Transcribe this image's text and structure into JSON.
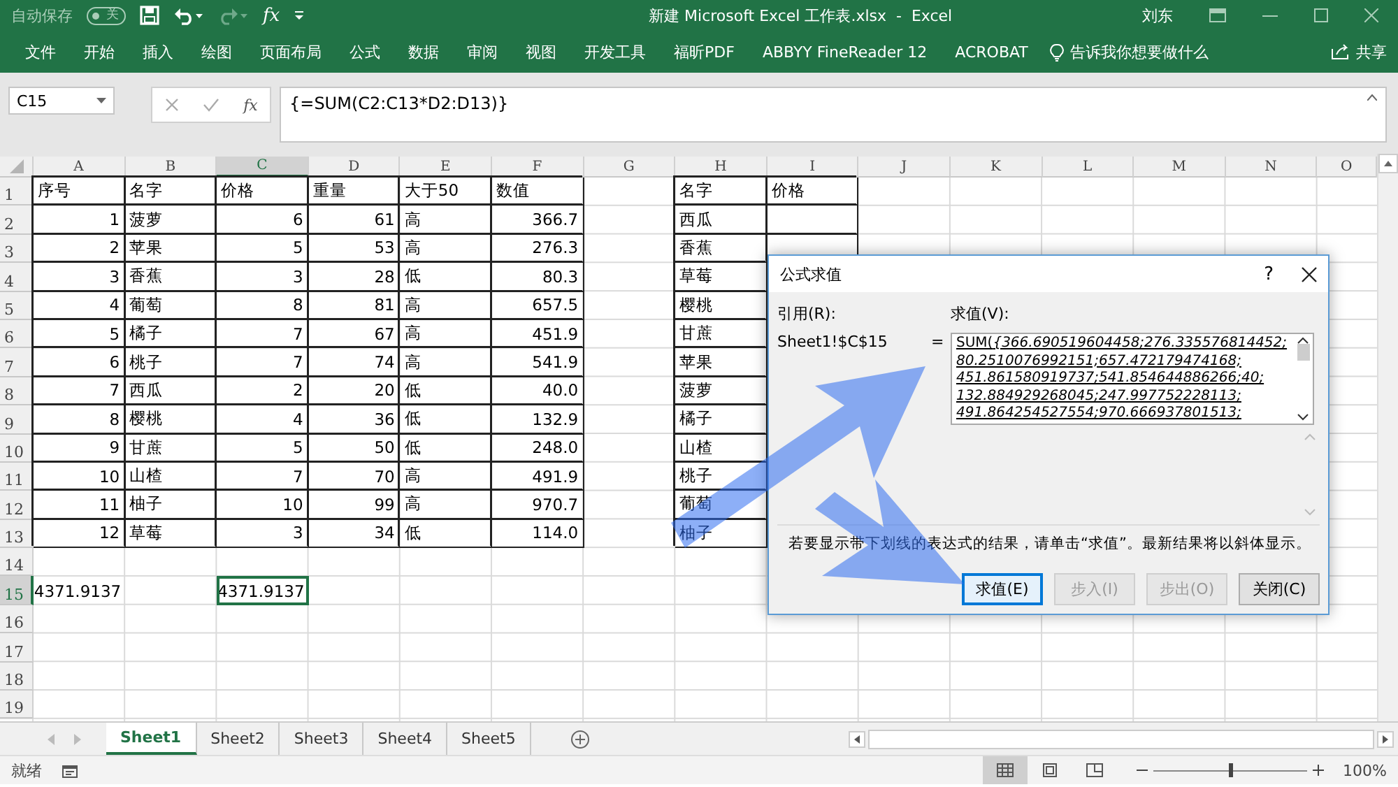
{
  "title_bar": {
    "autosave_label": "自动保存",
    "autosave_state": "关",
    "autosave_on": false,
    "function_glyph": "fx",
    "title": "新建 Microsoft Excel 工作表.xlsx  -  Excel",
    "user": "刘东"
  },
  "ribbon_tabs": [
    "文件",
    "开始",
    "插入",
    "绘图",
    "页面布局",
    "公式",
    "数据",
    "审阅",
    "视图",
    "开发工具",
    "福昕PDF",
    "ABBYY FineReader 12",
    "ACROBAT"
  ],
  "tell_me": "告诉我你想要做什么",
  "share": "共享",
  "formula_bar": {
    "name_box": "C15",
    "function_glyph": "fx",
    "formula": "{=SUM(C2:C13*D2:D13)}"
  },
  "sheet": {
    "columns": [
      {
        "label": "A",
        "selected": false
      },
      {
        "label": "B",
        "selected": false
      },
      {
        "label": "C",
        "selected": true
      },
      {
        "label": "D",
        "selected": false
      },
      {
        "label": "E",
        "selected": false
      },
      {
        "label": "F",
        "selected": false
      },
      {
        "label": "G",
        "selected": false
      },
      {
        "label": "H",
        "selected": false
      },
      {
        "label": "I",
        "selected": false
      },
      {
        "label": "J",
        "selected": false
      },
      {
        "label": "K",
        "selected": false
      },
      {
        "label": "L",
        "selected": false
      },
      {
        "label": "M",
        "selected": false
      },
      {
        "label": "N",
        "selected": false
      },
      {
        "label": "O",
        "selected": false
      }
    ],
    "rows": [
      {
        "header": "1",
        "selected": false,
        "cells": [
          {
            "text": "序号",
            "kind": "text",
            "bordered": true
          },
          {
            "text": "名字",
            "kind": "text",
            "bordered": true
          },
          {
            "text": "价格",
            "kind": "text",
            "bordered": true
          },
          {
            "text": "重量",
            "kind": "text",
            "bordered": true
          },
          {
            "text": "大于50",
            "kind": "text",
            "bordered": true
          },
          {
            "text": "数值",
            "kind": "text",
            "bordered": true
          },
          null,
          {
            "text": "名字",
            "kind": "text",
            "bordered": true
          },
          {
            "text": "价格",
            "kind": "text",
            "bordered": true
          }
        ]
      },
      {
        "header": "2",
        "selected": false,
        "cells": [
          {
            "text": "1",
            "kind": "number",
            "bordered": true
          },
          {
            "text": "菠萝",
            "kind": "text",
            "bordered": true
          },
          {
            "text": "6",
            "kind": "number",
            "bordered": true
          },
          {
            "text": "61",
            "kind": "number",
            "bordered": true
          },
          {
            "text": "高",
            "kind": "text",
            "bordered": true
          },
          {
            "text": "366.7",
            "kind": "number",
            "bordered": true
          },
          null,
          {
            "text": "西瓜",
            "kind": "text",
            "bordered": true
          },
          {
            "bordered": true
          }
        ]
      },
      {
        "header": "3",
        "selected": false,
        "cells": [
          {
            "text": "2",
            "kind": "number",
            "bordered": true
          },
          {
            "text": "苹果",
            "kind": "text",
            "bordered": true
          },
          {
            "text": "5",
            "kind": "number",
            "bordered": true
          },
          {
            "text": "53",
            "kind": "number",
            "bordered": true
          },
          {
            "text": "高",
            "kind": "text",
            "bordered": true
          },
          {
            "text": "276.3",
            "kind": "number",
            "bordered": true
          },
          null,
          {
            "text": "香蕉",
            "kind": "text",
            "bordered": true
          },
          {
            "bordered": true
          }
        ]
      },
      {
        "header": "4",
        "selected": false,
        "cells": [
          {
            "text": "3",
            "kind": "number",
            "bordered": true
          },
          {
            "text": "香蕉",
            "kind": "text",
            "bordered": true
          },
          {
            "text": "3",
            "kind": "number",
            "bordered": true
          },
          {
            "text": "28",
            "kind": "number",
            "bordered": true
          },
          {
            "text": "低",
            "kind": "text",
            "bordered": true
          },
          {
            "text": "80.3",
            "kind": "number",
            "bordered": true
          },
          null,
          {
            "text": "草莓",
            "kind": "text",
            "bordered": true
          }
        ]
      },
      {
        "header": "5",
        "selected": false,
        "cells": [
          {
            "text": "4",
            "kind": "number",
            "bordered": true
          },
          {
            "text": "葡萄",
            "kind": "text",
            "bordered": true
          },
          {
            "text": "8",
            "kind": "number",
            "bordered": true
          },
          {
            "text": "81",
            "kind": "number",
            "bordered": true
          },
          {
            "text": "高",
            "kind": "text",
            "bordered": true
          },
          {
            "text": "657.5",
            "kind": "number",
            "bordered": true
          },
          null,
          {
            "text": "樱桃",
            "kind": "text",
            "bordered": true
          }
        ]
      },
      {
        "header": "6",
        "selected": false,
        "cells": [
          {
            "text": "5",
            "kind": "number",
            "bordered": true
          },
          {
            "text": "橘子",
            "kind": "text",
            "bordered": true
          },
          {
            "text": "7",
            "kind": "number",
            "bordered": true
          },
          {
            "text": "67",
            "kind": "number",
            "bordered": true
          },
          {
            "text": "高",
            "kind": "text",
            "bordered": true
          },
          {
            "text": "451.9",
            "kind": "number",
            "bordered": true
          },
          null,
          {
            "text": "甘蔗",
            "kind": "text",
            "bordered": true
          }
        ]
      },
      {
        "header": "7",
        "selected": false,
        "cells": [
          {
            "text": "6",
            "kind": "number",
            "bordered": true
          },
          {
            "text": "桃子",
            "kind": "text",
            "bordered": true
          },
          {
            "text": "7",
            "kind": "number",
            "bordered": true
          },
          {
            "text": "74",
            "kind": "number",
            "bordered": true
          },
          {
            "text": "高",
            "kind": "text",
            "bordered": true
          },
          {
            "text": "541.9",
            "kind": "number",
            "bordered": true
          },
          null,
          {
            "text": "苹果",
            "kind": "text",
            "bordered": true
          }
        ]
      },
      {
        "header": "8",
        "selected": false,
        "cells": [
          {
            "text": "7",
            "kind": "number",
            "bordered": true
          },
          {
            "text": "西瓜",
            "kind": "text",
            "bordered": true
          },
          {
            "text": "2",
            "kind": "number",
            "bordered": true
          },
          {
            "text": "20",
            "kind": "number",
            "bordered": true
          },
          {
            "text": "低",
            "kind": "text",
            "bordered": true
          },
          {
            "text": "40.0",
            "kind": "number",
            "bordered": true
          },
          null,
          {
            "text": "菠萝",
            "kind": "text",
            "bordered": true
          }
        ]
      },
      {
        "header": "9",
        "selected": false,
        "cells": [
          {
            "text": "8",
            "kind": "number",
            "bordered": true
          },
          {
            "text": "樱桃",
            "kind": "text",
            "bordered": true
          },
          {
            "text": "4",
            "kind": "number",
            "bordered": true
          },
          {
            "text": "36",
            "kind": "number",
            "bordered": true
          },
          {
            "text": "低",
            "kind": "text",
            "bordered": true
          },
          {
            "text": "132.9",
            "kind": "number",
            "bordered": true
          },
          null,
          {
            "text": "橘子",
            "kind": "text",
            "bordered": true
          }
        ]
      },
      {
        "header": "10",
        "selected": false,
        "cells": [
          {
            "text": "9",
            "kind": "number",
            "bordered": true
          },
          {
            "text": "甘蔗",
            "kind": "text",
            "bordered": true
          },
          {
            "text": "5",
            "kind": "number",
            "bordered": true
          },
          {
            "text": "50",
            "kind": "number",
            "bordered": true
          },
          {
            "text": "低",
            "kind": "text",
            "bordered": true
          },
          {
            "text": "248.0",
            "kind": "number",
            "bordered": true
          },
          null,
          {
            "text": "山楂",
            "kind": "text",
            "bordered": true
          }
        ]
      },
      {
        "header": "11",
        "selected": false,
        "cells": [
          {
            "text": "10",
            "kind": "number",
            "bordered": true
          },
          {
            "text": "山楂",
            "kind": "text",
            "bordered": true
          },
          {
            "text": "7",
            "kind": "number",
            "bordered": true
          },
          {
            "text": "70",
            "kind": "number",
            "bordered": true
          },
          {
            "text": "高",
            "kind": "text",
            "bordered": true
          },
          {
            "text": "491.9",
            "kind": "number",
            "bordered": true
          },
          null,
          {
            "text": "桃子",
            "kind": "text",
            "bordered": true
          }
        ]
      },
      {
        "header": "12",
        "selected": false,
        "cells": [
          {
            "text": "11",
            "kind": "number",
            "bordered": true
          },
          {
            "text": "柚子",
            "kind": "text",
            "bordered": true
          },
          {
            "text": "10",
            "kind": "number",
            "bordered": true
          },
          {
            "text": "99",
            "kind": "number",
            "bordered": true
          },
          {
            "text": "高",
            "kind": "text",
            "bordered": true
          },
          {
            "text": "970.7",
            "kind": "number",
            "bordered": true
          },
          null,
          {
            "text": "葡萄",
            "kind": "text",
            "bordered": true
          }
        ]
      },
      {
        "header": "13",
        "selected": false,
        "cells": [
          {
            "text": "12",
            "kind": "number",
            "bordered": true
          },
          {
            "text": "草莓",
            "kind": "text",
            "bordered": true
          },
          {
            "text": "3",
            "kind": "number",
            "bordered": true
          },
          {
            "text": "34",
            "kind": "number",
            "bordered": true
          },
          {
            "text": "低",
            "kind": "text",
            "bordered": true
          },
          {
            "text": "114.0",
            "kind": "number",
            "bordered": true
          },
          null,
          {
            "text": "柚子",
            "kind": "text",
            "bordered": true
          }
        ]
      },
      {
        "header": "14",
        "selected": false,
        "cells": []
      },
      {
        "header": "15",
        "selected": true,
        "cells": [
          {
            "text": "4371.9137",
            "kind": "number",
            "bordered": false
          },
          null,
          {
            "text": "4371.9137",
            "kind": "number",
            "bordered": false,
            "selected": true
          }
        ]
      },
      {
        "header": "16",
        "selected": false,
        "cells": []
      },
      {
        "header": "17",
        "selected": false,
        "cells": []
      },
      {
        "header": "18",
        "selected": false,
        "cells": []
      },
      {
        "header": "19",
        "selected": false,
        "cells": []
      }
    ]
  },
  "dialog": {
    "title": "公式求值",
    "help": "?",
    "reference_label": "引用(R):",
    "evaluation_label": "求值(V):",
    "reference": "Sheet1!$C$15",
    "equals": "=",
    "evaluation_prefix": "SUM(",
    "evaluation_lines": [
      "{366.690519604458;276.335576814452;",
      "80.2510076992151;657.472179474168;",
      "451.861580919737;541.854644886266;40;",
      "132.884929268045;247.997752228113;",
      "491.864254527554;970.666937801513;"
    ],
    "note": "若要显示带下划线的表达式的结果，请单击“求值”。最新结果将以斜体显示。",
    "buttons": [
      {
        "label": "求值(E)",
        "disabled": false,
        "selected": true
      },
      {
        "label": "步入(I)",
        "disabled": true,
        "selected": false
      },
      {
        "label": "步出(O)",
        "disabled": true,
        "selected": false
      },
      {
        "label": "关闭(C)",
        "disabled": false,
        "selected": false
      }
    ]
  },
  "sheet_tabs": [
    {
      "label": "Sheet1",
      "selected": true
    },
    {
      "label": "Sheet2",
      "selected": false
    },
    {
      "label": "Sheet3",
      "selected": false
    },
    {
      "label": "Sheet4",
      "selected": false
    },
    {
      "label": "Sheet5",
      "selected": false
    }
  ],
  "status_bar": {
    "status": "就绪",
    "views": [
      {
        "kind": "normal",
        "selected": true
      },
      {
        "kind": "page_layout",
        "selected": false
      },
      {
        "kind": "page_break",
        "selected": false
      }
    ],
    "zoom_slider": {
      "level": 0.5
    },
    "zoom": "100%"
  }
}
